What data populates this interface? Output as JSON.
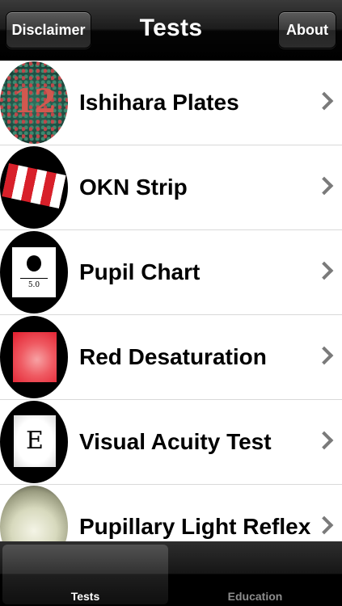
{
  "navbar": {
    "title": "Tests",
    "left_button": "Disclaimer",
    "right_button": "About"
  },
  "list": {
    "items": [
      {
        "label": "Ishihara Plates",
        "thumb_text": "12"
      },
      {
        "label": "OKN Strip"
      },
      {
        "label": "Pupil Chart",
        "thumb_text": "5.0"
      },
      {
        "label": "Red Desaturation"
      },
      {
        "label": "Visual Acuity Test",
        "thumb_text": "E"
      },
      {
        "label": "Pupillary Light Reflex"
      }
    ]
  },
  "tabbar": {
    "tabs": [
      {
        "label": "Tests",
        "selected": true
      },
      {
        "label": "Education",
        "selected": false
      }
    ]
  },
  "colors": {
    "selected_tab_text": "#ffffff",
    "unselected_tab_text": "#8c8c8c",
    "chevron": "#7a7a7a"
  }
}
